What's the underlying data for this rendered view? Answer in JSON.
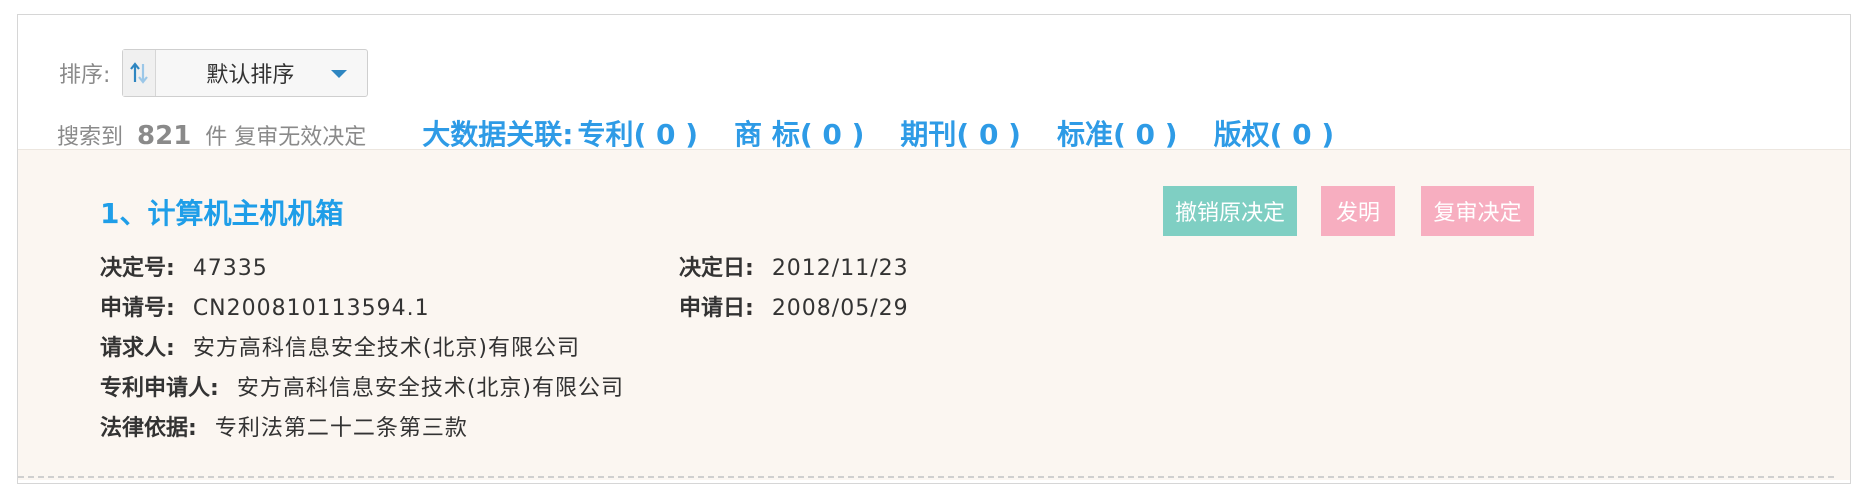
{
  "sort": {
    "label": "排序:",
    "selected": "默认排序"
  },
  "summary": {
    "prefix": "搜索到",
    "count": "821",
    "suffix": "件 复审无效决定"
  },
  "bigdata": {
    "label": "大数据关联:",
    "links": [
      "专利( 0 )",
      "商 标( 0 )",
      "期刊( 0 )",
      "标准( 0 )",
      "版权( 0 )"
    ]
  },
  "result": {
    "title": "1、计算机主机机箱",
    "buttons": [
      "撤销原决定",
      "发明",
      "复审决定"
    ],
    "button_colors": {
      "teal": "#7fcfc3",
      "pink": "#f7aec0"
    },
    "fields": {
      "decision_no_label": "决定号:",
      "decision_no": "47335",
      "decision_date_label": "决定日:",
      "decision_date": "2012/11/23",
      "application_no_label": "申请号:",
      "application_no": "CN200810113594.1",
      "application_date_label": "申请日:",
      "application_date": "2008/05/29",
      "requester_label": "请求人:",
      "requester": "安方高科信息安全技术(北京)有限公司",
      "patent_applicant_label": "专利申请人:",
      "patent_applicant": "安方高科信息安全技术(北京)有限公司",
      "legal_basis_label": "法律依据:",
      "legal_basis": "专利法第二十二条第三款"
    }
  },
  "colors": {
    "link_blue": "#2e9be6",
    "card_bg": "#fbf6f1",
    "muted_text": "#8a8a8a"
  }
}
